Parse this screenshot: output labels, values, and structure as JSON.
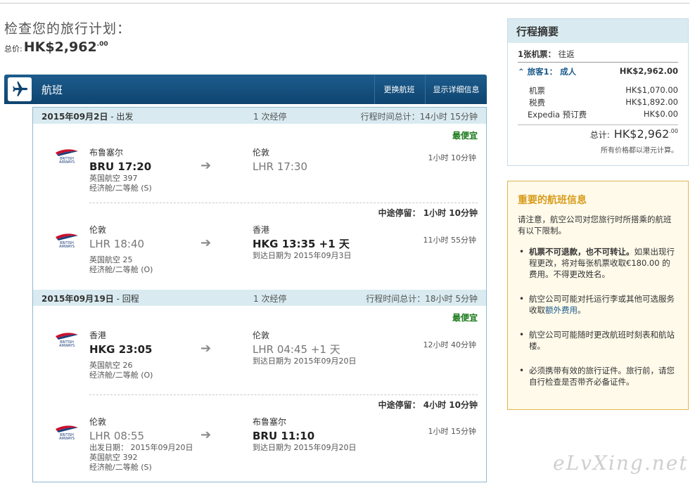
{
  "page": {
    "title": "检查您的旅行计划：",
    "total_label": "总价:",
    "total_price": "HK$2,962",
    "total_cents": ".00"
  },
  "flight_header": {
    "title": "航班",
    "change_label": "更换航班",
    "detail_label": "显示详细信息"
  },
  "segments": [
    {
      "date": "2015年09月2日",
      "kind": " - 出发",
      "stops": "1 次经停",
      "total_duration": "行程时间总计：14小时 15分钟",
      "cheapest": "最便宜",
      "legs": [
        {
          "from_city": "布鲁塞尔",
          "from": "BRU 17:20",
          "to_city": "伦敦",
          "to": "LHR 17:30",
          "airline": "英国航空 397",
          "cabin": "经济舱/二等舱 (S)",
          "duration": "1小时 10分钟",
          "arrival_note": "",
          "depart_note": ""
        },
        {
          "from_city": "伦敦",
          "from": "LHR 18:40",
          "to_city": "香港",
          "to": "HKG 13:35 +1 天",
          "airline": "英国航空 25",
          "cabin": "经济舱/二等舱 (O)",
          "duration": "11小时 55分钟",
          "arrival_note": "到达日期为 2015年09月3日",
          "depart_note": ""
        }
      ],
      "layover": {
        "label": "中途停留：",
        "duration": "1小时 10分钟"
      }
    },
    {
      "date": "2015年09月19日",
      "kind": " - 回程",
      "stops": "1 次经停",
      "total_duration": "行程时间总计：18小时 5分钟",
      "cheapest": "最便宜",
      "legs": [
        {
          "from_city": "香港",
          "from": "HKG 23:05",
          "to_city": "伦敦",
          "to": "LHR 04:45 +1 天",
          "airline": "英国航空 26",
          "cabin": "经济舱/二等舱 (O)",
          "duration": "12小时 40分钟",
          "arrival_note": "到达日期为 2015年09月20日",
          "depart_note": ""
        },
        {
          "from_city": "伦敦",
          "from": "LHR 08:55",
          "to_city": "布鲁塞尔",
          "to": "BRU 11:10",
          "airline": "英国航空 392",
          "cabin": "经济舱/二等舱 (S)",
          "duration": "1小时 15分钟",
          "arrival_note": "到达日期为 2015年09月20日",
          "depart_note": "出发日期： 2015年09月20日"
        }
      ],
      "layover": {
        "label": "中途停留：",
        "duration": "4小时 10分钟"
      }
    }
  ],
  "summary": {
    "title": "行程摘要",
    "tickets": "1张机票：",
    "trip_type": "往返",
    "traveler_label": "旅客1： 成人",
    "traveler_price": "HK$2,962.00",
    "fees": [
      {
        "label": "机票",
        "value": "HK$1,070.00"
      },
      {
        "label": "税费",
        "value": "HK$1,892.00"
      },
      {
        "label": "Expedia 预订费",
        "value": "HK$0.00"
      }
    ],
    "total_label": "总计:",
    "total_price": "HK$2,962",
    "total_cents": ".00",
    "note": "所有价格都以港元计算。"
  },
  "important": {
    "title": "重要的航班信息",
    "intro": "请注意，航空公司对您旅行时所搭乘的航班有以下限制。",
    "items": [
      {
        "bold": "机票不可退款，也不可转让。",
        "text": "如果出现行程更改，将对每张机票收取€180.00 的费用。不得更改姓名。"
      },
      {
        "text": "航空公司可能对托运行李或其他可选服务收取",
        "link": "额外费用",
        "tail": "。"
      },
      {
        "text": "航空公司可能随时更改航班时刻表和航站楼。"
      },
      {
        "text": "必须携带有效的旅行证件。旅行前，请您自行检查是否带齐必备证件。"
      }
    ]
  },
  "watermark": "eLvXing.net",
  "colors": {
    "header_blue": "#1d5c8c",
    "segment_bg": "#d9ebf1",
    "cheapest_green": "#1a7a1a",
    "important_gold": "#d89c1c"
  },
  "icons": {
    "flight": "airplane-icon",
    "airline_logo": "british-airways-logo",
    "arrow": "arrow-right-icon"
  }
}
